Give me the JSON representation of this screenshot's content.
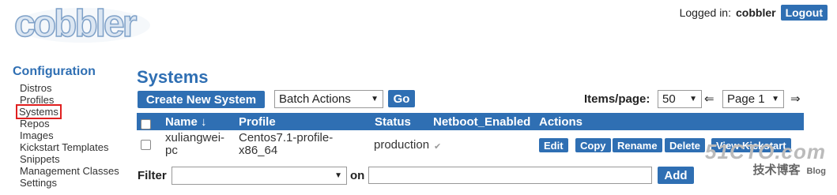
{
  "header": {
    "logo_text": "cobbler",
    "logged_in_label": "Logged in:",
    "username": "cobbler",
    "logout_label": "Logout"
  },
  "sidebar": {
    "heading": "Configuration",
    "items": [
      {
        "label": "Distros"
      },
      {
        "label": "Profiles"
      },
      {
        "label": "Systems"
      },
      {
        "label": "Repos"
      },
      {
        "label": "Images"
      },
      {
        "label": "Kickstart Templates"
      },
      {
        "label": "Snippets"
      },
      {
        "label": "Management Classes"
      },
      {
        "label": "Settings"
      }
    ]
  },
  "main": {
    "title": "Systems",
    "create_label": "Create New System",
    "batch_value": "Batch Actions",
    "go_label": "Go",
    "items_per_page_label": "Items/page:",
    "items_per_page_value": "50",
    "prev_arrow": "⇐",
    "page_value": "Page 1",
    "next_arrow": "⇒"
  },
  "table": {
    "columns": [
      "Name ↓",
      "Profile",
      "Status",
      "Netboot_Enabled",
      "Actions"
    ],
    "rows": [
      {
        "name_line1": "xuliangwei-",
        "name_line2": "pc",
        "profile_line1": "Centos7.1-profile-",
        "profile_line2": "x86_64",
        "status": "production",
        "netboot_mark": "✔",
        "actions": [
          "Edit",
          "Copy",
          "Rename",
          "Delete",
          "View Kickstart"
        ]
      }
    ]
  },
  "filter": {
    "label": "Filter",
    "select_value": "",
    "on_label": "on",
    "input_value": "",
    "add_label": "Add"
  },
  "watermark": {
    "site": "51CTO.com",
    "subtitle": "技术博客",
    "blog": "Blog"
  },
  "colors": {
    "accent": "#2f6fb3",
    "highlight": "#e02020"
  }
}
